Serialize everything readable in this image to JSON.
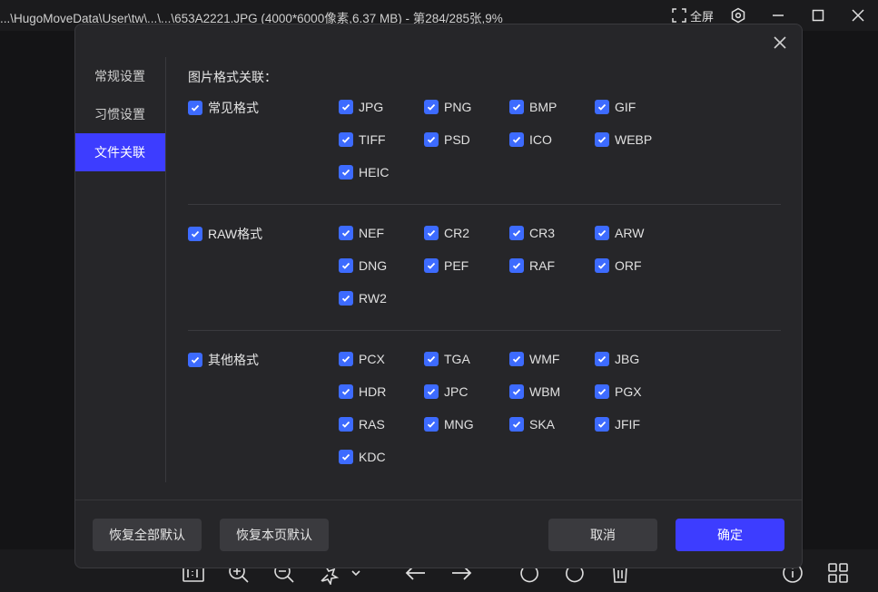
{
  "titlebar": {
    "title": "...\\HugoMoveData\\User\\tw\\...\\...\\653A2221.JPG (4000*6000像素,6.37 MB) - 第284/285张,9%",
    "fullscreen_label": "全屏"
  },
  "dialog": {
    "sidebar": [
      "常规设置",
      "习惯设置",
      "文件关联"
    ],
    "section_title": "图片格式关联：",
    "groups": [
      {
        "label": "常见格式",
        "items": [
          "JPG",
          "PNG",
          "BMP",
          "GIF",
          "TIFF",
          "PSD",
          "ICO",
          "WEBP",
          "HEIC"
        ]
      },
      {
        "label": "RAW格式",
        "items": [
          "NEF",
          "CR2",
          "CR3",
          "ARW",
          "DNG",
          "PEF",
          "RAF",
          "ORF",
          "RW2"
        ]
      },
      {
        "label": "其他格式",
        "items": [
          "PCX",
          "TGA",
          "WMF",
          "JBG",
          "HDR",
          "JPC",
          "WBM",
          "PGX",
          "RAS",
          "MNG",
          "SKA",
          "JFIF",
          "KDC"
        ]
      }
    ],
    "buttons": {
      "restore_all": "恢复全部默认",
      "restore_page": "恢复本页默认",
      "cancel": "取消",
      "ok": "确定"
    }
  },
  "colors": {
    "accent": "#3d3dff",
    "checkbox": "#3d6bff",
    "dialog_bg": "#262629"
  }
}
